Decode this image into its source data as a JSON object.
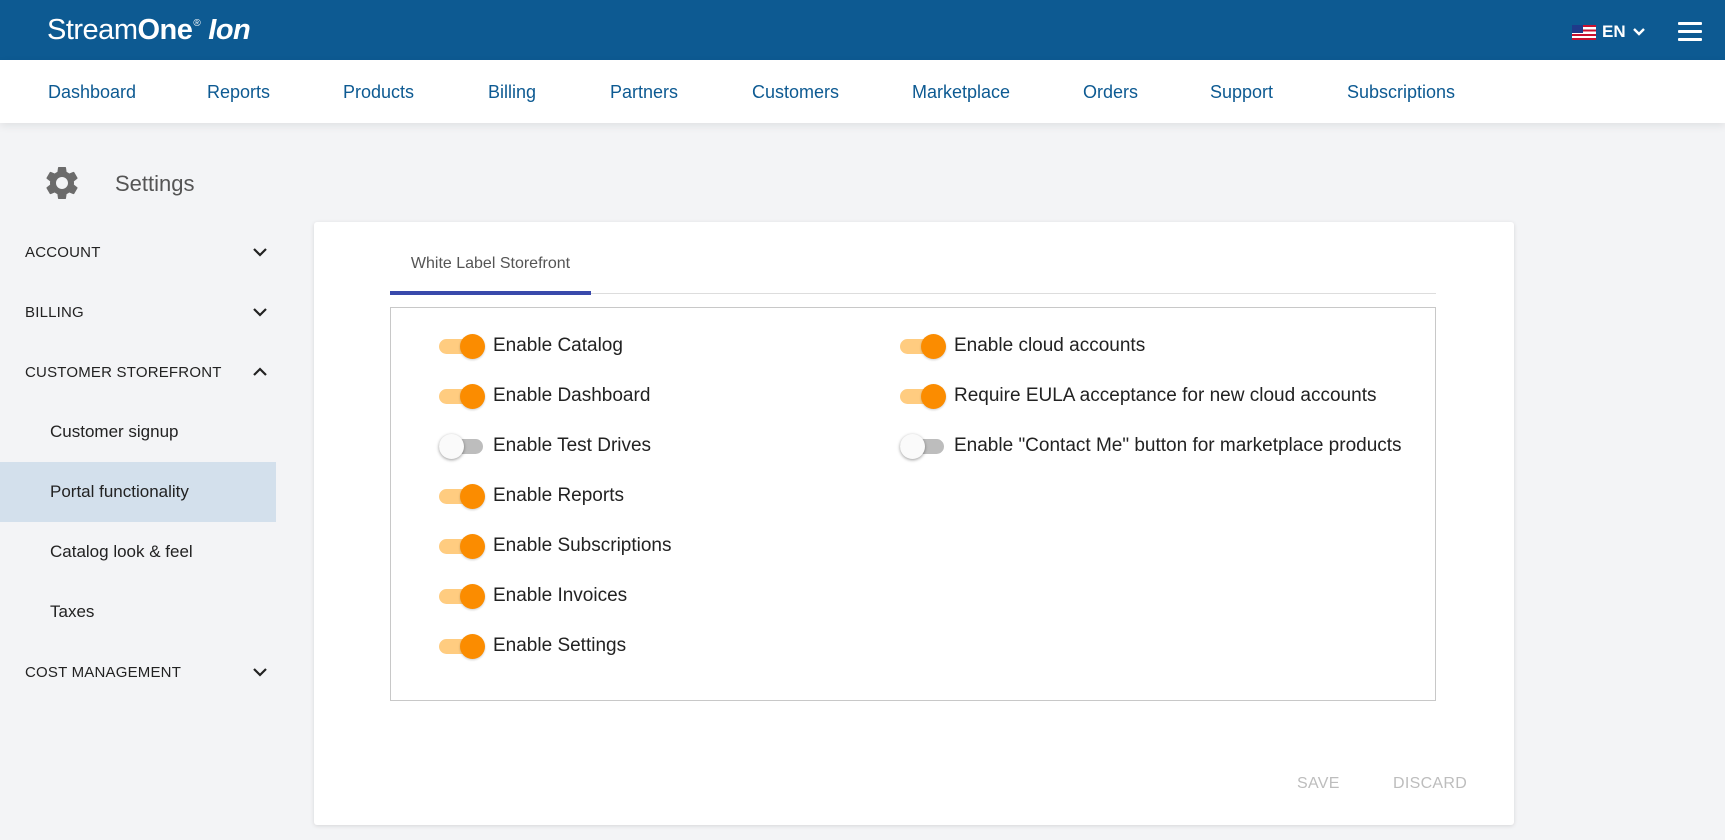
{
  "brand": {
    "part1": "Stream",
    "part2": "One",
    "registered": "®",
    "part3": "Ion"
  },
  "language": {
    "label": "EN",
    "flag_icon": "us-flag-icon"
  },
  "nav": [
    "Dashboard",
    "Reports",
    "Products",
    "Billing",
    "Partners",
    "Customers",
    "Marketplace",
    "Orders",
    "Support",
    "Subscriptions"
  ],
  "settings": {
    "title": "Settings"
  },
  "sidebar": {
    "account": "ACCOUNT",
    "billing": "BILLING",
    "customer_storefront": "CUSTOMER STOREFRONT",
    "customer_signup": "Customer signup",
    "portal_functionality": "Portal functionality",
    "catalog_look_feel": "Catalog look & feel",
    "taxes": "Taxes",
    "cost_management": "COST MANAGEMENT"
  },
  "tab": {
    "label": "White Label Storefront"
  },
  "options_left": [
    {
      "label": "Enable Catalog",
      "on": true
    },
    {
      "label": "Enable Dashboard",
      "on": true
    },
    {
      "label": "Enable Test Drives",
      "on": false
    },
    {
      "label": "Enable Reports",
      "on": true
    },
    {
      "label": "Enable Subscriptions",
      "on": true
    },
    {
      "label": "Enable Invoices",
      "on": true
    },
    {
      "label": "Enable Settings",
      "on": true
    }
  ],
  "options_right": [
    {
      "label": "Enable cloud accounts",
      "on": true
    },
    {
      "label": "Require EULA acceptance for new cloud accounts",
      "on": true
    },
    {
      "label": "Enable \"Contact Me\" button for marketplace products",
      "on": false
    }
  ],
  "actions": {
    "save": "SAVE",
    "discard": "DISCARD"
  },
  "colors": {
    "header": "#0d5a92",
    "accent": "#fb8c00",
    "tab_indicator": "#3949ab",
    "active_item": "#d3e0ec"
  }
}
